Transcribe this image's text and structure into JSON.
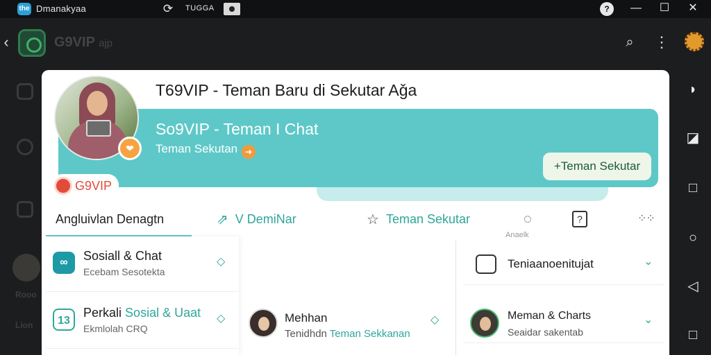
{
  "system_bar": {
    "app_name": "Dmanakyaa",
    "label": "TUGGA",
    "minimize": "—",
    "maximize": "☐",
    "close": "✕"
  },
  "app_bar": {
    "back": "‹",
    "title": "G9VIP",
    "title_suffix": "ajp"
  },
  "ghost_rail": {
    "text_1": "Rooo",
    "text_2": "Lion"
  },
  "card": {
    "title": "T69VIP - Teman Baru di Sekutar Aǧa",
    "hero": {
      "title": "So9VIP - Teman I Chat",
      "subtitle": "Teman Sekutan",
      "button": "+Teman Sekutar"
    },
    "brand": "G9VIP",
    "tabs": [
      {
        "label": "Angluivlan Denagtn",
        "icon": ""
      },
      {
        "label": "V DemiNar",
        "icon": "recycle-icon"
      },
      {
        "label": "Teman Sekutar",
        "icon": "star-icon"
      },
      {
        "label": "",
        "icon": "chat-bubble-icon"
      },
      {
        "label": "",
        "icon": "question-icon"
      }
    ],
    "tab_sub": "Anaelk",
    "left_items": [
      {
        "title": "Sosiall & Chat",
        "subtitle": "Ecebam Sesotekta",
        "icon": "link-icon",
        "icon_color": "#1d9aa6"
      },
      {
        "title_prefix": "Perkali",
        "title_accent": "Sosial & Uaat",
        "subtitle": "Ekmlolah CRQ",
        "icon": "id-card-icon",
        "icon_color": "#2fa69b"
      }
    ],
    "mid_item": {
      "title": "Mehhan",
      "subtitle_prefix": "Tenidhdn",
      "subtitle_accent": "Teman Sekkanan"
    },
    "right_items": [
      {
        "title": "Teniaanoenitujat",
        "icon": "edit-icon"
      },
      {
        "title": "Meman & Charts",
        "subtitle": "Seaidar sakentab",
        "icon": "avatar"
      }
    ]
  },
  "colors": {
    "accent": "#5ec8c8",
    "accent_dark": "#2fa69b",
    "brand": "#e24b3b"
  }
}
